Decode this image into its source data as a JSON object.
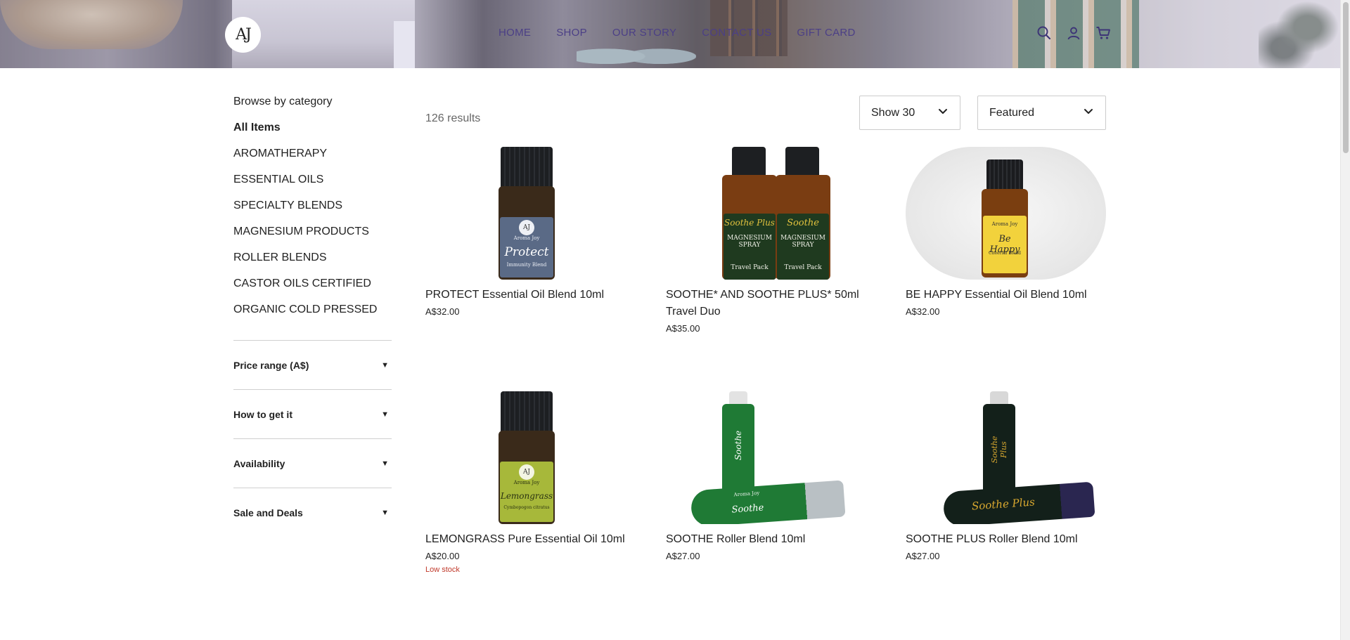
{
  "header": {
    "logo_text": "AJ",
    "nav": [
      "HOME",
      "SHOP",
      "OUR STORY",
      "CONTACT US",
      "GIFT CARD"
    ],
    "icons": [
      "search-icon",
      "account-icon",
      "cart-icon"
    ]
  },
  "sidebar": {
    "browse_title": "Browse by category",
    "categories": [
      {
        "label": "All Items",
        "active": true
      },
      {
        "label": "AROMATHERAPY"
      },
      {
        "label": "ESSENTIAL OILS"
      },
      {
        "label": "SPECIALTY BLENDS"
      },
      {
        "label": "MAGNESIUM PRODUCTS"
      },
      {
        "label": "ROLLER BLENDS"
      },
      {
        "label": "CASTOR OILS CERTIFIED"
      },
      {
        "label": "ORGANIC COLD PRESSED"
      }
    ],
    "filters": [
      "Price range (A$)",
      "How to get it",
      "Availability",
      "Sale and Deals"
    ]
  },
  "main": {
    "results_text": "126 results",
    "show_select": "Show 30",
    "sort_select": "Featured",
    "products": [
      {
        "name": "PROTECT Essential Oil Blend 10ml",
        "price": "A$32.00",
        "image_label": "Protect",
        "image_sub": "Immunity Blend",
        "brand": "Aroma Joy"
      },
      {
        "name": "SOOTHE* AND SOOTHE PLUS* 50ml Travel Duo",
        "price": "A$35.00",
        "image_label": "Soothe Plus",
        "image_label2": "Soothe",
        "image_sub": "MAGNESIUM SPRAY",
        "image_sub2": "Travel Pack"
      },
      {
        "name": "BE HAPPY Essential Oil Blend 10ml",
        "price": "A$32.00",
        "image_label": "Be Happy",
        "image_sub": "Cheerful Blend",
        "brand": "Aroma Joy"
      },
      {
        "name": "LEMONGRASS Pure Essential Oil 10ml",
        "price": "A$20.00",
        "stock": "Low stock",
        "image_label": "Lemongrass",
        "image_sub": "Cymbopogon citratus",
        "brand": "Aroma Joy"
      },
      {
        "name": "SOOTHE Roller Blend 10ml",
        "price": "A$27.00",
        "image_label": "Soothe",
        "brand": "Aroma Joy"
      },
      {
        "name": "SOOTHE PLUS Roller Blend 10ml",
        "price": "A$27.00",
        "image_label": "Soothe Plus"
      }
    ]
  },
  "colors": {
    "nav_text": "#4b3f86",
    "low_stock": "#c0392b",
    "protect_label": "#5a6a86",
    "happy_label": "#f2d23c",
    "lemongrass_label": "#a7b83a",
    "soothe_green": "#1f7a35",
    "soothe_plus_dark": "#13201a"
  }
}
